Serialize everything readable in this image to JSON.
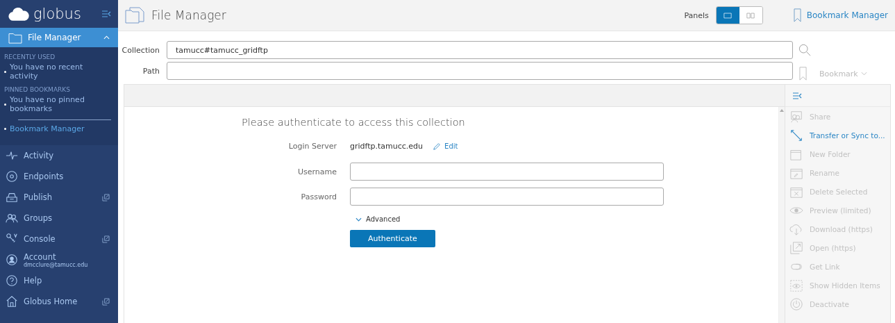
{
  "sidebar": {
    "logo": "globus",
    "section": {
      "label": "File Manager",
      "selected": true,
      "expanded": true
    },
    "groups": [
      {
        "heading": "RECENTLY USED",
        "items": [
          "You have no recent activity"
        ]
      },
      {
        "heading": "PINNED BOOKMARKS",
        "items": [
          "You have no pinned bookmarks"
        ]
      }
    ],
    "bookmark_link": "Bookmark Manager",
    "items": [
      {
        "label": "Activity",
        "external": false
      },
      {
        "label": "Endpoints",
        "external": false
      },
      {
        "label": "Publish",
        "external": true
      },
      {
        "label": "Groups",
        "external": false
      },
      {
        "label": "Console",
        "external": true
      },
      {
        "label": "Account",
        "sublabel": "dmcclure@tamucc.edu",
        "external": false
      },
      {
        "label": "Help",
        "external": false
      },
      {
        "label": "Globus Home",
        "external": true
      }
    ]
  },
  "header": {
    "title": "File Manager",
    "panels_label": "Panels",
    "panels": [
      {
        "selected": true
      },
      {
        "selected": false
      }
    ],
    "bookmark_manager": "Bookmark Manager"
  },
  "collection": {
    "label": "Collection",
    "value": "tamucc#tamucc_gridftp"
  },
  "path": {
    "label": "Path",
    "bookmark": "Bookmark"
  },
  "auth": {
    "title": "Please authenticate to access this collection",
    "server_label": "Login Server",
    "server": "gridftp.tamucc.edu",
    "edit": "Edit",
    "fields": [
      {
        "label": "Username"
      },
      {
        "label": "Password"
      }
    ],
    "advanced": {
      "label": "Advanced",
      "expanded": false
    },
    "submit": "Authenticate"
  },
  "actions": [
    {
      "label": "Share",
      "disabled": true
    },
    {
      "label": "Transfer or Sync to...",
      "disabled": false
    },
    {
      "label": "New Folder",
      "disabled": true
    },
    {
      "label": "Rename",
      "disabled": true
    },
    {
      "label": "Delete Selected",
      "disabled": true
    },
    {
      "label": "Preview (limited)",
      "disabled": true
    },
    {
      "label": "Download (https)",
      "disabled": true
    },
    {
      "label": "Open (https)",
      "disabled": true
    },
    {
      "label": "Get Link",
      "disabled": true
    },
    {
      "label": "Show Hidden Items",
      "disabled": true
    },
    {
      "label": "Deactivate",
      "disabled": true
    }
  ]
}
